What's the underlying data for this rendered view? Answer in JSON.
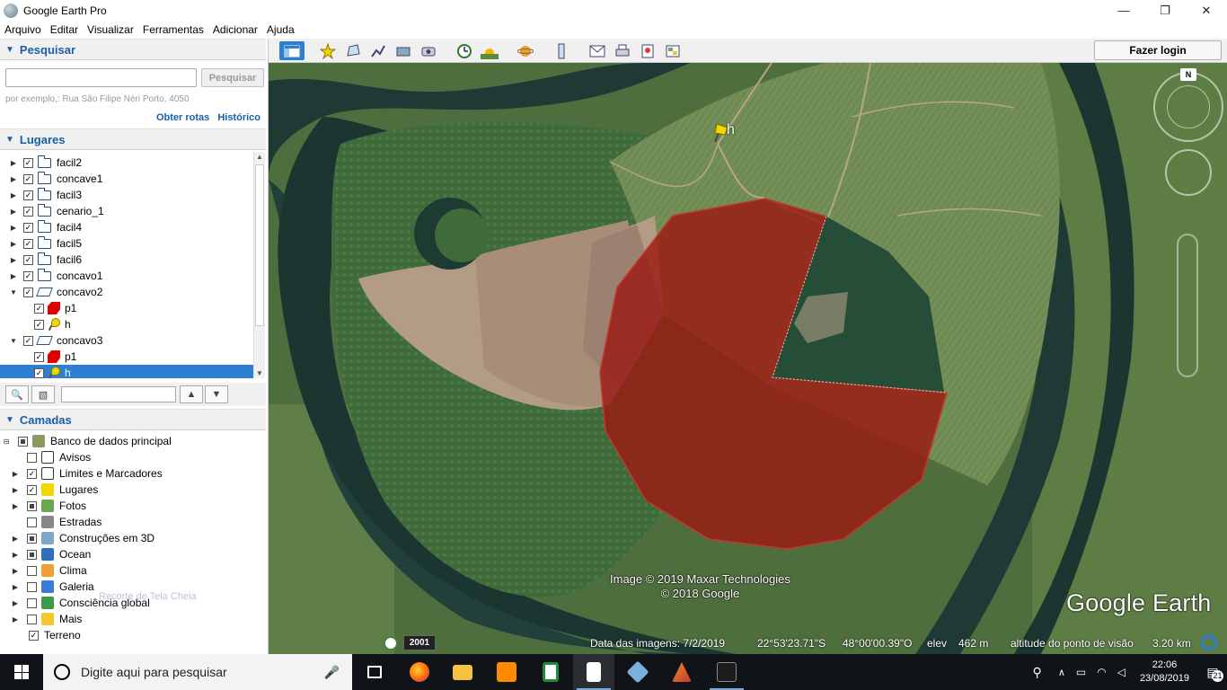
{
  "window": {
    "title": "Google Earth Pro",
    "controls": {
      "minimize": "—",
      "maximize": "❐",
      "close": "✕"
    }
  },
  "menu": [
    "Arquivo",
    "Editar",
    "Visualizar",
    "Ferramentas",
    "Adicionar",
    "Ajuda"
  ],
  "search": {
    "header": "Pesquisar",
    "input_value": "",
    "button": "Pesquisar",
    "hint": "por exemplo,: Rua São Filipe Néri Porto, 4050",
    "link_routes": "Obter rotas",
    "link_history": "Histórico"
  },
  "places": {
    "header": "Lugares",
    "items": [
      {
        "label": "facil2",
        "icon": "folder-icon",
        "checked": true,
        "level": 0
      },
      {
        "label": "concave1",
        "icon": "folder-icon",
        "checked": true,
        "level": 0
      },
      {
        "label": "facil3",
        "icon": "folder-icon",
        "checked": true,
        "level": 0
      },
      {
        "label": "cenario_1",
        "icon": "folder-icon",
        "checked": true,
        "level": 0
      },
      {
        "label": "facil4",
        "icon": "folder-icon",
        "checked": true,
        "level": 0
      },
      {
        "label": "facil5",
        "icon": "folder-icon",
        "checked": true,
        "level": 0
      },
      {
        "label": "facil6",
        "icon": "folder-icon",
        "checked": true,
        "level": 0
      },
      {
        "label": "concavo1",
        "icon": "folder-icon",
        "checked": true,
        "level": 0
      },
      {
        "label": "concavo2",
        "icon": "folder-open-icon",
        "checked": true,
        "level": 0,
        "expanded": true
      },
      {
        "label": "p1",
        "icon": "polygon-icon",
        "checked": true,
        "level": 1
      },
      {
        "label": "h",
        "icon": "pushpin-icon",
        "checked": true,
        "level": 1
      },
      {
        "label": "concavo3",
        "icon": "folder-open-icon",
        "checked": true,
        "level": 0,
        "expanded": true
      },
      {
        "label": "p1",
        "icon": "polygon-icon",
        "checked": true,
        "level": 1
      },
      {
        "label": "h",
        "icon": "pushpin-icon",
        "checked": true,
        "level": 1,
        "selected": true
      }
    ],
    "filter_value": ""
  },
  "layers": {
    "header": "Camadas",
    "items": [
      {
        "label": "Banco de dados principal",
        "icon": "database-icon",
        "level": 0,
        "state": "partial",
        "color": "#8a9a5b"
      },
      {
        "label": "Avisos",
        "icon": "envelope-icon",
        "level": 1,
        "state": "off",
        "color": "#ffffff"
      },
      {
        "label": "Limites e Marcadores",
        "icon": "flag-icon",
        "level": 1,
        "state": "on",
        "color": "#ffffff"
      },
      {
        "label": "Lugares",
        "icon": "places-icon",
        "level": 1,
        "state": "on",
        "color": "#f2d600"
      },
      {
        "label": "Fotos",
        "icon": "photo-icon",
        "level": 1,
        "state": "partial",
        "color": "#6aa84f"
      },
      {
        "label": "Estradas",
        "icon": "roads-icon",
        "level": 1,
        "state": "off",
        "color": "#888888"
      },
      {
        "label": "Construções em 3D",
        "icon": "buildings-icon",
        "level": 1,
        "state": "partial",
        "color": "#7fa7c9"
      },
      {
        "label": "Ocean",
        "icon": "ocean-icon",
        "level": 1,
        "state": "partial",
        "color": "#2d6fb8"
      },
      {
        "label": "Clima",
        "icon": "weather-icon",
        "level": 1,
        "state": "off",
        "color": "#f0a030"
      },
      {
        "label": "Galeria",
        "icon": "gallery-icon",
        "level": 1,
        "state": "off",
        "color": "#3a7bd5"
      },
      {
        "label": "Consciência global",
        "icon": "globe-icon",
        "level": 1,
        "state": "off",
        "color": "#3a9a4a"
      },
      {
        "label": "Mais",
        "icon": "more-icon",
        "level": 1,
        "state": "off",
        "color": "#f2c830"
      },
      {
        "label": "Terreno",
        "icon": "",
        "level": 0,
        "state": "on",
        "color": ""
      }
    ],
    "faded_overlay_text": "Recorte de Tela Cheia"
  },
  "toolbar": {
    "login": "Fazer login"
  },
  "map": {
    "placemark_label": "h",
    "attribution_line1": "Image © 2019 Maxar Technologies",
    "attribution_line2": "© 2018 Google",
    "logo": "Google Earth",
    "history_year": "2001",
    "status": {
      "image_date": "Data das imagens: 7/2/2019",
      "latitude": "22°53'23.71\"S",
      "longitude": "48°00'00.39\"O",
      "elev_label": "elev",
      "elev_value": "462 m",
      "eye_alt_label": "altitude do ponto de visão",
      "eye_alt_value": "3.20 km"
    },
    "compass_label": "N",
    "polygon_color": "#9b1a12"
  },
  "taskbar": {
    "search_placeholder": "Digite aqui para pesquisar",
    "time": "22:06",
    "date": "23/08/2019",
    "notification_count": "21"
  }
}
